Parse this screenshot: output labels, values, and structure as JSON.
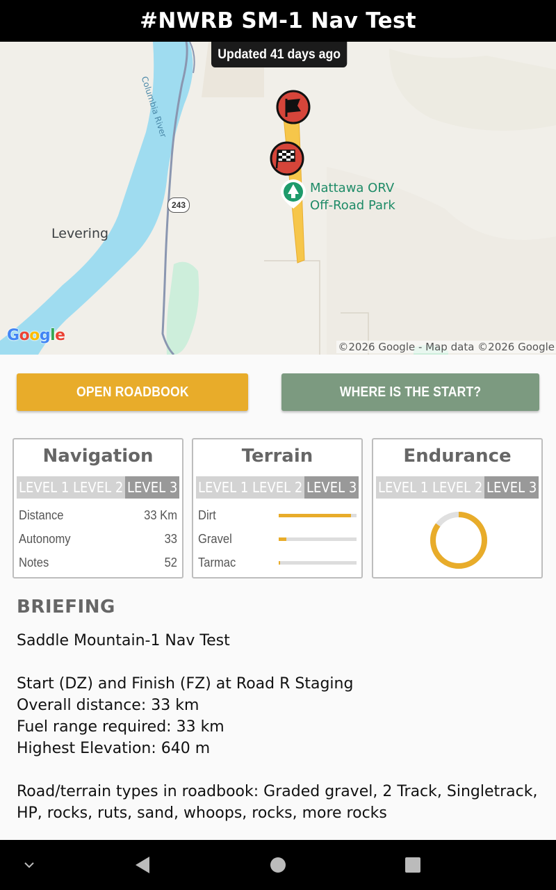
{
  "header": {
    "title": "#NWRB SM-1 Nav Test"
  },
  "map": {
    "updated_label": "Updated 41 days ago",
    "place_levering": "Levering",
    "park_line1": "Mattawa ORV",
    "park_line2": "Off-Road Park",
    "river_label": "Columbia River",
    "highway_number": "243",
    "attribution": "©2026 Google - Map data ©2026 Google",
    "logo_letters": [
      "G",
      "o",
      "o",
      "g",
      "l",
      "e"
    ],
    "route_color": "#f6c64a",
    "water_color": "#9fdcf0",
    "start_marker_icon": "flag-icon",
    "finish_marker_icon": "checkered-flag-icon",
    "park_marker_icon": "tree-pin-icon"
  },
  "actions": {
    "open_roadbook": "OPEN ROADBOOK",
    "where_start": "WHERE IS THE START?"
  },
  "cards": {
    "navigation": {
      "title": "Navigation",
      "levels": [
        "LEVEL 1",
        "LEVEL 2",
        "LEVEL 3"
      ],
      "active_level": 3,
      "stats": [
        {
          "label": "Distance",
          "value": "33 Km"
        },
        {
          "label": "Autonomy",
          "value": "33"
        },
        {
          "label": "Notes",
          "value": "52"
        }
      ]
    },
    "terrain": {
      "title": "Terrain",
      "levels": [
        "LEVEL 1",
        "LEVEL 2",
        "LEVEL 3"
      ],
      "active_level": 3,
      "types": [
        {
          "label": "Dirt",
          "fraction": 0.93
        },
        {
          "label": "Gravel",
          "fraction": 0.1
        },
        {
          "label": "Tarmac",
          "fraction": 0.02
        }
      ]
    },
    "endurance": {
      "title": "Endurance",
      "levels": [
        "LEVEL 1",
        "LEVEL 2",
        "LEVEL 3"
      ],
      "active_level": 3,
      "gauge_fraction": 0.85
    }
  },
  "briefing": {
    "title": "BRIEFING",
    "lines": [
      "Saddle Mountain-1 Nav Test",
      "",
      "Start (DZ) and Finish (FZ) at Road R Staging",
      "Overall distance: 33 km",
      "Fuel range required: 33 km",
      "Highest Elevation: 640 m",
      "",
      "Road/terrain types in roadbook: Graded gravel, 2 Track, Singletrack, HP, rocks, ruts, sand, whoops, rocks, more rocks"
    ]
  },
  "colors": {
    "accent": "#e8ac2a",
    "secondary_button": "#7c9a80",
    "level_active": "#999999",
    "level_inactive": "#d3d3d3"
  },
  "system_nav": {
    "icons": [
      "chevron-down-icon",
      "back-icon",
      "home-icon",
      "recents-icon"
    ]
  }
}
